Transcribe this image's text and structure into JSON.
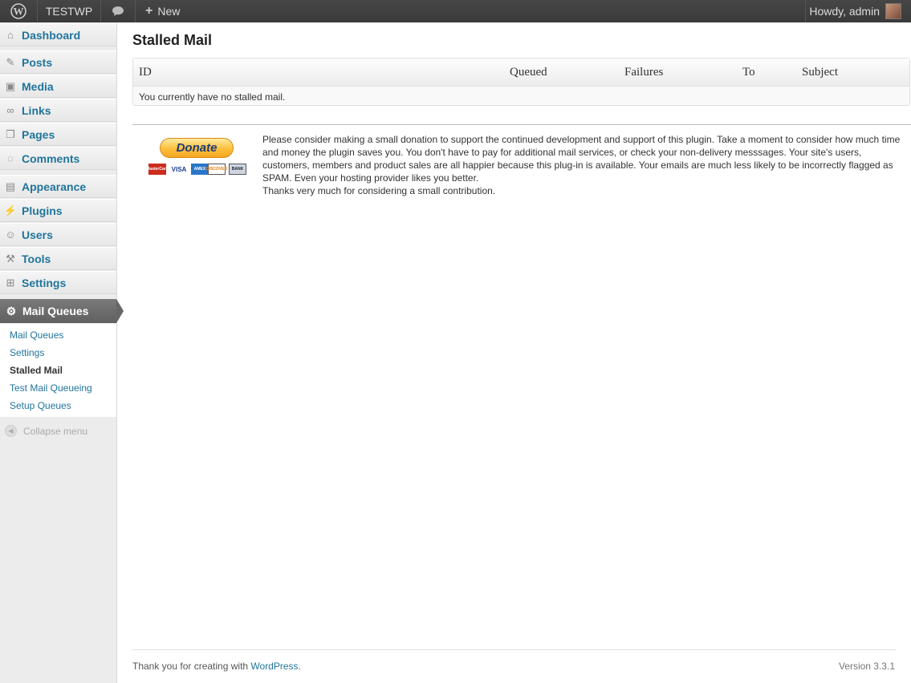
{
  "adminbar": {
    "site_name": "TESTWP",
    "new_label": "New",
    "account_label": "Howdy, admin",
    "icons": [
      "wordpress-logo-icon",
      "comment-bubble-icon",
      "plus-icon",
      "avatar"
    ]
  },
  "sidebar": {
    "items": [
      {
        "label": "Dashboard",
        "icon": "dashboard-icon"
      },
      {
        "label": "Posts",
        "icon": "pin-icon"
      },
      {
        "label": "Media",
        "icon": "media-icon"
      },
      {
        "label": "Links",
        "icon": "link-icon"
      },
      {
        "label": "Pages",
        "icon": "pages-icon"
      },
      {
        "label": "Comments",
        "icon": "comment-icon"
      },
      {
        "label": "Appearance",
        "icon": "appearance-icon"
      },
      {
        "label": "Plugins",
        "icon": "plugin-icon"
      },
      {
        "label": "Users",
        "icon": "users-icon"
      },
      {
        "label": "Tools",
        "icon": "tools-icon"
      },
      {
        "label": "Settings",
        "icon": "settings-icon"
      }
    ],
    "current_menu": {
      "label": "Mail Queues",
      "icon": "gear-icon"
    },
    "submenu": [
      "Mail Queues",
      "Settings",
      "Stalled Mail",
      "Test Mail Queueing",
      "Setup Queues"
    ],
    "collapse_label": "Collapse menu"
  },
  "main": {
    "title": "Stalled Mail",
    "table": {
      "columns": [
        "ID",
        "Queued",
        "Failures",
        "To",
        "Subject"
      ],
      "empty_message": "You currently have no stalled mail."
    },
    "donate": {
      "button_label": "Donate",
      "cards": [
        "MasterCard",
        "VISA",
        "AMEX",
        "DISCOVER",
        "BANK"
      ],
      "text": "Please consider making a small donation to support the continued development and support of this plugin. Take a moment to consider how much time and money the plugin saves you. You don't have to pay for additional mail services, or check your non-delivery messsages. Your site's users, customers, members and product sales are all happier because this plug-in is available. Your emails are much less likely to be incorrectly flagged as SPAM. Even your hosting provider likes you better.",
      "thanks": "Thanks very much for considering a small contribution."
    }
  },
  "footer": {
    "thanks_prefix": "Thank you for creating with ",
    "wordpress_link": "WordPress",
    "thanks_suffix": ".",
    "version": "Version 3.3.1"
  }
}
